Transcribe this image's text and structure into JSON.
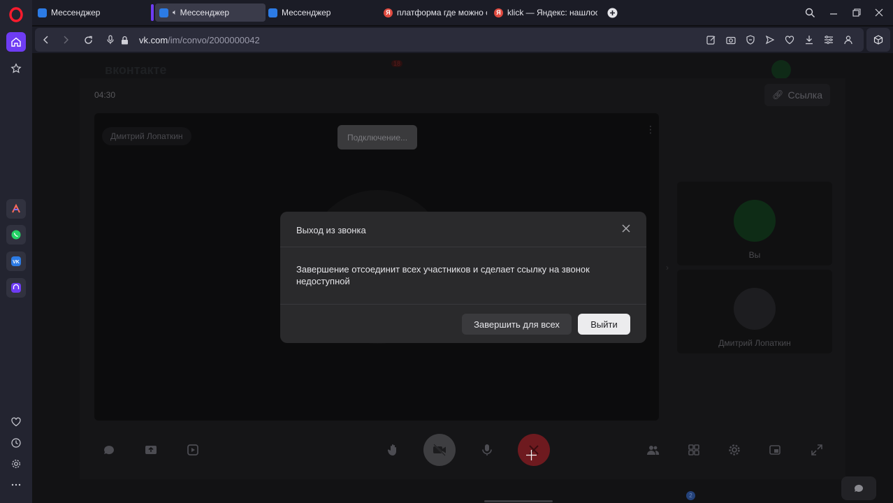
{
  "browser": {
    "tabs": [
      {
        "label": "Мессенджер",
        "icon": "vk-messenger-icon"
      },
      {
        "label": "Мессенджер",
        "icon": "vk-messenger-icon",
        "active": true,
        "sound": true
      },
      {
        "label": "Мессенджер",
        "icon": "vk-messenger-icon"
      },
      {
        "label": "платформа где можно ст",
        "icon": "yandex-icon"
      },
      {
        "label": "klick — Яндекс: нашлось",
        "icon": "yandex-icon"
      }
    ],
    "url_host": "vk.com",
    "url_path": "/im/convo/2000000042"
  },
  "page": {
    "brand": "вконтакте",
    "notif_count": "18"
  },
  "call": {
    "timer": "04:30",
    "link_label": "Ссылка",
    "main_participant": "Дмитрий Лопаткин",
    "connecting_label": "Подключение...",
    "tiles": [
      {
        "name": "Вы"
      },
      {
        "name": "Дмитрий Лопаткин"
      }
    ],
    "participants_count": "2"
  },
  "modal": {
    "title": "Выход из звонка",
    "body": "Завершение отсоединит всех участников и сделает ссылку на звонок недоступной",
    "end_all_label": "Завершить для всех",
    "leave_label": "Выйти"
  },
  "colors": {
    "opera_accent": "#6e3cf3",
    "end_call_red": "#8a1d22",
    "you_avatar_green": "#1f8a3c"
  }
}
